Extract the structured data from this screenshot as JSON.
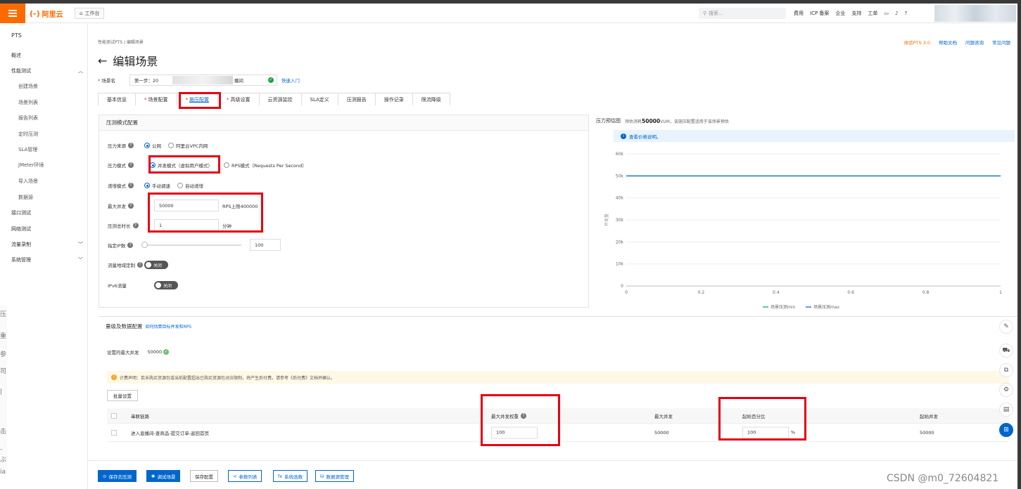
{
  "topbar": {
    "logo_mark": "(-)",
    "logo_text": "阿里云",
    "workbench": "工作台",
    "search_placeholder": "搜索...",
    "links": [
      "费用",
      "ICP 备案",
      "企业",
      "支持",
      "工单"
    ]
  },
  "sidebar": {
    "title": "PTS",
    "items": [
      {
        "label": "概述",
        "arrow": ""
      },
      {
        "label": "性能测试",
        "arrow": "︿"
      },
      {
        "label": "创建场景",
        "arrow": "",
        "sub": true
      },
      {
        "label": "场景列表",
        "arrow": "",
        "sub": true
      },
      {
        "label": "报告列表",
        "arrow": "",
        "sub": true
      },
      {
        "label": "定时压测",
        "arrow": "",
        "sub": true
      },
      {
        "label": "SLA管理",
        "arrow": "",
        "sub": true
      },
      {
        "label": "JMeter环境",
        "arrow": "",
        "sub": true
      },
      {
        "label": "导入场景",
        "arrow": "",
        "sub": true
      },
      {
        "label": "数据源",
        "arrow": "",
        "sub": true
      },
      {
        "label": "接口测试",
        "arrow": ""
      },
      {
        "label": "网络测试",
        "arrow": ""
      },
      {
        "label": "流量录制",
        "arrow": "﹀"
      },
      {
        "label": "系统管理",
        "arrow": "﹀"
      }
    ],
    "edge_chars": [
      "压",
      "重",
      "参",
      "司",
      "|",
      "击",
      "-",
      "ぷ",
      "ia"
    ]
  },
  "header": {
    "breadcrumb": "性能测试PTS  /  编辑场景",
    "title": "编辑场景",
    "back_icon": "←",
    "right_links": [
      "体验PTS 3.0",
      "帮助文档",
      "问题咨询",
      "常见问题"
    ]
  },
  "scene": {
    "label": "场景名",
    "value_prefix": "第一步：20",
    "value_suffix": "播间",
    "quick_link": "快速入门"
  },
  "tabs": [
    {
      "label": "基本信息",
      "required": false,
      "active": false
    },
    {
      "label": "场景配置",
      "required": true,
      "active": false
    },
    {
      "label": "施压配置",
      "required": true,
      "active": true
    },
    {
      "label": "高级设置",
      "required": true,
      "active": false
    },
    {
      "label": "云资源监控",
      "required": false,
      "active": false
    },
    {
      "label": "SLA定义",
      "required": false,
      "active": false
    },
    {
      "label": "压测报告",
      "required": false,
      "active": false
    },
    {
      "label": "操作记录",
      "required": false,
      "active": false
    },
    {
      "label": "限流降级",
      "required": false,
      "active": false
    }
  ],
  "pressure": {
    "panel_title": "压测模式配置",
    "source_label": "压力来源",
    "source_options": [
      "公网",
      "阿里云VPC内网"
    ],
    "mode_label": "压力模式",
    "mode_options": [
      "并发模式（虚拟用户模式）",
      "RPS模式（Requests Per Second）"
    ],
    "ramp_label": "递增模式",
    "ramp_options": [
      "手动调速",
      "自动递增"
    ],
    "max_conc_label": "最大并发",
    "max_conc_value": "50000",
    "rps_limit": "RPS上限400000",
    "duration_label": "压测总时长",
    "duration_value": "1",
    "duration_unit": "分钟",
    "ip_label": "指定IP数",
    "ip_value": "100",
    "ip_level": 0,
    "traffic_label": "流量地域定制",
    "traffic_toggle": "关闭",
    "ipv6_label": "IPv6流量",
    "ipv6_toggle": "关闭"
  },
  "chart_head": {
    "title": "压力预估图",
    "subtitle_prefix": "预估消耗",
    "subtitle_value": "50000",
    "subtitle_suffix": "VUM，该施压配置适用于该场景预估",
    "info": "查看价格说明。"
  },
  "chart_data": {
    "type": "line",
    "title": "",
    "xlabel": "",
    "ylabel": "并发量",
    "xlim": [
      0,
      1
    ],
    "ylim": [
      0,
      60000
    ],
    "x_ticks": [
      "0",
      "0.2",
      "0.4",
      "0.6",
      "0.8",
      "1"
    ],
    "y_ticks": [
      "0",
      "10k",
      "20k",
      "30k",
      "40k",
      "50k",
      "60k"
    ],
    "grid": true,
    "legend_position": "bottom",
    "series": [
      {
        "name": "场景压测min",
        "color": "#2fb57e",
        "x": [
          0,
          1
        ],
        "values": [
          50000,
          50000
        ]
      },
      {
        "name": "场景压测max",
        "color": "#2f7fd6",
        "x": [
          0,
          1
        ],
        "values": [
          50000,
          50000
        ]
      }
    ]
  },
  "levels": {
    "title": "量级及数据配置",
    "link": "如何估算目标并发和RPS",
    "set_max_label": "设置的最大并发",
    "set_max_value": "50000",
    "warn_text": "计费声明：若未购买资源包或当前配置超出已购买资源包对应限制，将产生后付费。请参考《后付费》文档并确认。",
    "batch_btn": "批量设置",
    "columns": [
      "串联链路",
      "最大并发权重",
      "最大并发",
      "起始百分比",
      "起始并发"
    ],
    "rows": [
      {
        "link": "进入直播间-查商品-提交订单-返回首页",
        "weight": "100",
        "max_conc": "50000",
        "start_pct": "100",
        "pct_unit": "%",
        "start_conc": "50000"
      }
    ]
  },
  "bottom": {
    "buttons": [
      "保存去压测",
      "调试场景",
      "保存配置",
      "参数列表",
      "系统函数",
      "数据源管理"
    ]
  },
  "watermark": "CSDN @m0_72604821",
  "colors": {
    "brand": "#ff6a00",
    "accent": "#0066cc",
    "annotation": "#e60012"
  }
}
